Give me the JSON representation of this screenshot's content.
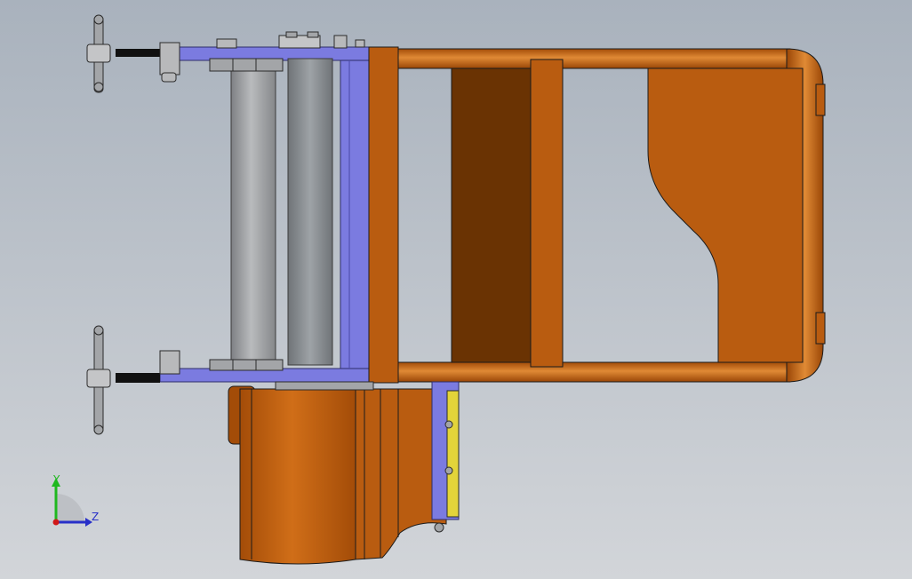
{
  "viewport": {
    "background_top": "#aeb6c0",
    "background_bottom": "#cfd3d8"
  },
  "colors": {
    "orange": "#b95c10",
    "orange_light": "#d8822e",
    "orange_dark": "#7a3a06",
    "orange_deep": "#6a3303",
    "blue_plate": "#7b7be0",
    "blue_edge": "#3b3b8a",
    "steel": "#a3a5a8",
    "steel_dark": "#75787c",
    "yellow": "#e3d43a",
    "outline": "#1b1b1b"
  },
  "triad": {
    "x_label": "",
    "y_label": "Y",
    "z_label": "Z",
    "y_color": "#1fb81f",
    "z_color": "#2830c8",
    "x_color": "#d01818"
  }
}
